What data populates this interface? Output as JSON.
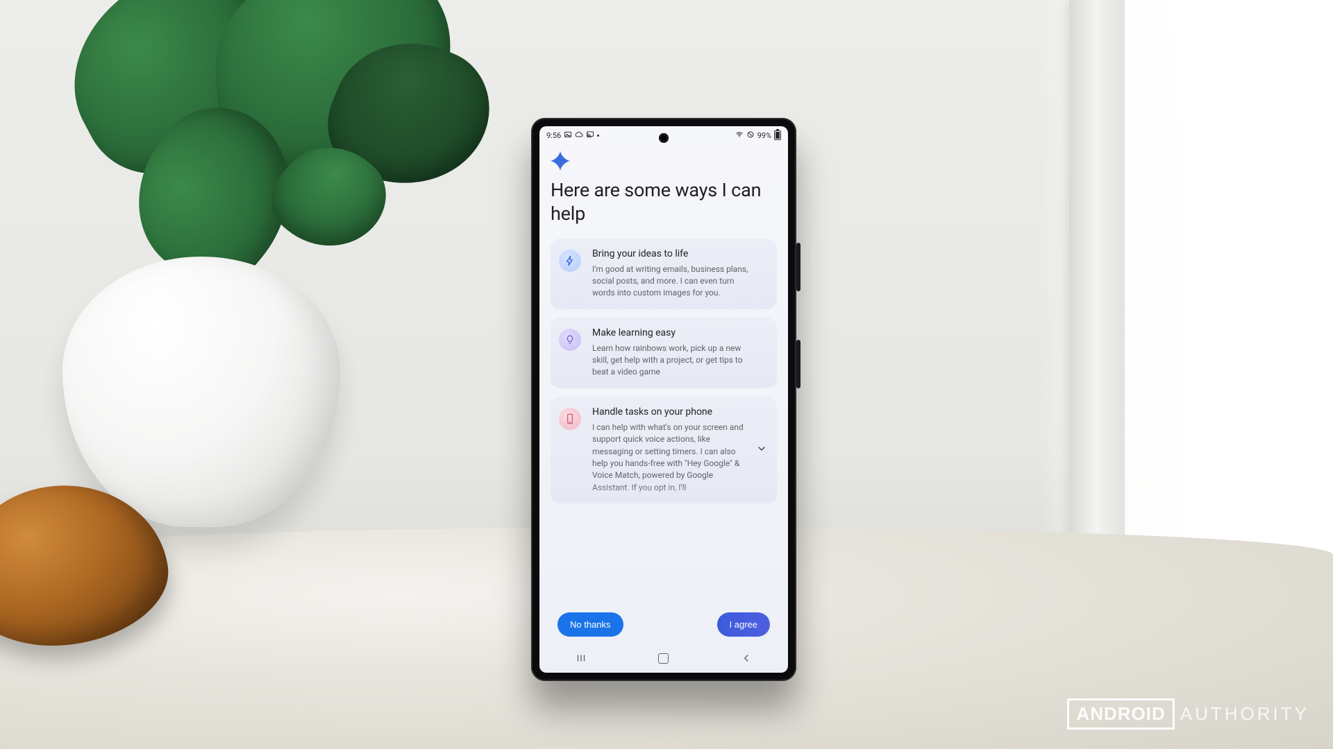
{
  "watermark": {
    "brand_boxed": "ANDROID",
    "brand_plain": "AUTHORITY"
  },
  "statusbar": {
    "time": "9:56",
    "battery_percent": "99%"
  },
  "headline": "Here are some ways I can help",
  "cards": [
    {
      "icon": "bolt",
      "icon_tone": "blue",
      "title": "Bring your ideas to life",
      "desc": "I'm good at writing emails, business plans, social posts, and more. I can even turn words into custom images for you.",
      "expandable": false
    },
    {
      "icon": "bulb",
      "icon_tone": "lav",
      "title": "Make learning easy",
      "desc": "Learn how rainbows work, pick up a new skill, get help with a project, or get tips to beat a video game",
      "expandable": false
    },
    {
      "icon": "phone",
      "icon_tone": "rose",
      "title": "Handle tasks on your phone",
      "desc": "I can help with what's on your screen and support quick voice actions, like messaging or setting timers. I can also help you hands-free with \"Hey Google\" & Voice Match, powered by Google Assistant. If you opt in, I'll",
      "expandable": true
    }
  ],
  "buttons": {
    "decline": "No thanks",
    "accept": "I agree"
  }
}
